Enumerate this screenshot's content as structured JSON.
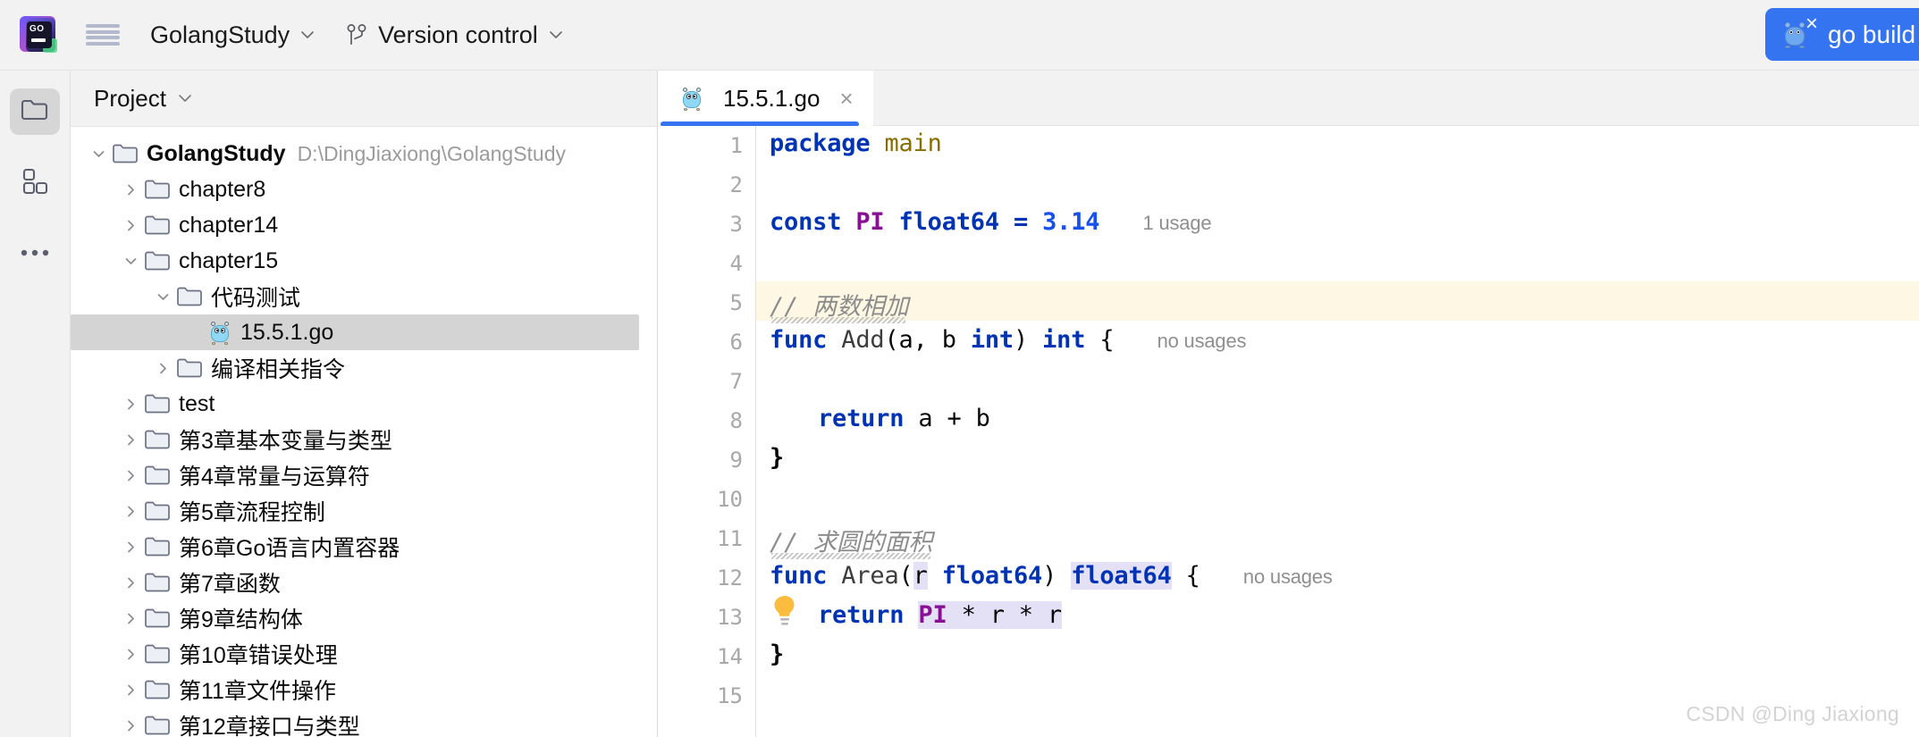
{
  "app": {
    "logo_name": "goland-logo",
    "project_menu": "GolangStudy",
    "vcs_menu": "Version control",
    "build_button_label": "go build ",
    "accent_color": "#3574f0",
    "topbar_bg": "#f2f2f2"
  },
  "rail": {
    "items": [
      {
        "name": "project-tool-window",
        "icon": "folder-icon",
        "active": true
      },
      {
        "name": "structure-tool-window",
        "icon": "blocks-icon",
        "active": false
      },
      {
        "name": "more-tool-windows",
        "icon": "ellipsis-icon",
        "active": false
      }
    ]
  },
  "panel": {
    "title": "Project",
    "root": {
      "label": "GolangStudy",
      "path": "D:\\DingJiaxiong\\GolangStudy"
    },
    "tree": [
      {
        "label": "GolangStudy",
        "path": "D:\\DingJiaxiong\\GolangStudy",
        "depth": 0,
        "state": "expanded",
        "kind": "folder",
        "bold": true
      },
      {
        "label": "chapter8",
        "path": "",
        "depth": 1,
        "state": "collapsed",
        "kind": "folder",
        "bold": false
      },
      {
        "label": "chapter14",
        "path": "",
        "depth": 1,
        "state": "collapsed",
        "kind": "folder",
        "bold": false
      },
      {
        "label": "chapter15",
        "path": "",
        "depth": 1,
        "state": "expanded",
        "kind": "folder",
        "bold": false
      },
      {
        "label": "代码测试",
        "path": "",
        "depth": 2,
        "state": "expanded",
        "kind": "folder",
        "bold": false
      },
      {
        "label": "15.5.1.go",
        "path": "",
        "depth": 3,
        "state": "none",
        "kind": "gofile",
        "bold": false,
        "selected": true
      },
      {
        "label": "编译相关指令",
        "path": "",
        "depth": 2,
        "state": "collapsed",
        "kind": "folder",
        "bold": false
      },
      {
        "label": "test",
        "path": "",
        "depth": 1,
        "state": "collapsed",
        "kind": "folder",
        "bold": false
      },
      {
        "label": "第3章基本变量与类型",
        "path": "",
        "depth": 1,
        "state": "collapsed",
        "kind": "folder",
        "bold": false
      },
      {
        "label": "第4章常量与运算符",
        "path": "",
        "depth": 1,
        "state": "collapsed",
        "kind": "folder",
        "bold": false
      },
      {
        "label": "第5章流程控制",
        "path": "",
        "depth": 1,
        "state": "collapsed",
        "kind": "folder",
        "bold": false
      },
      {
        "label": "第6章Go语言内置容器",
        "path": "",
        "depth": 1,
        "state": "collapsed",
        "kind": "folder",
        "bold": false
      },
      {
        "label": "第7章函数",
        "path": "",
        "depth": 1,
        "state": "collapsed",
        "kind": "folder",
        "bold": false
      },
      {
        "label": "第9章结构体",
        "path": "",
        "depth": 1,
        "state": "collapsed",
        "kind": "folder",
        "bold": false
      },
      {
        "label": "第10章错误处理",
        "path": "",
        "depth": 1,
        "state": "collapsed",
        "kind": "folder",
        "bold": false
      },
      {
        "label": "第11章文件操作",
        "path": "",
        "depth": 1,
        "state": "collapsed",
        "kind": "folder",
        "bold": false
      },
      {
        "label": "第12章接口与类型",
        "path": "",
        "depth": 1,
        "state": "collapsed",
        "kind": "folder",
        "bold": false
      }
    ]
  },
  "editor": {
    "tab": {
      "label": "15.5.1.go",
      "close": "×"
    },
    "line_numbers": [
      "1",
      "2",
      "3",
      "4",
      "5",
      "6",
      "7",
      "8",
      "9",
      "10",
      "11",
      "12",
      "13",
      "14",
      "15"
    ],
    "current_line": 13,
    "hints": {
      "line3": "1 usage",
      "line6": "no usages",
      "line12": "no usages"
    },
    "code": {
      "l1_package": "package",
      "l1_main": "main",
      "l3_const": "const",
      "l3_pi": "PI",
      "l3_type": "float64",
      "l3_eq": "=",
      "l3_val": "3.14",
      "l5_comment_slashes": "//",
      "l5_comment_text": "两数相加",
      "l6_func": "func",
      "l6_name": "Add",
      "l6_sig": "(a, b ",
      "l6_int1": "int",
      "l6_close": ") ",
      "l6_int2": "int",
      "l6_brace": " {",
      "l8_return": "return",
      "l8_expr": " a + b",
      "l9_brace": "}",
      "l11_comment_slashes": "//",
      "l11_comment_text": "求圆的面积",
      "l12_func": "func",
      "l12_name": "Area",
      "l12_paren": "(",
      "l12_r": "r",
      "l12_sp": " ",
      "l12_type1": "float64",
      "l12_close": ") ",
      "l12_type2": "float64",
      "l12_brace": " {",
      "l13_return": "return",
      "l13_pi": "PI",
      "l13_expr": " * r * r",
      "l14_brace": "}"
    }
  },
  "watermark": "CSDN @Ding Jiaxiong"
}
